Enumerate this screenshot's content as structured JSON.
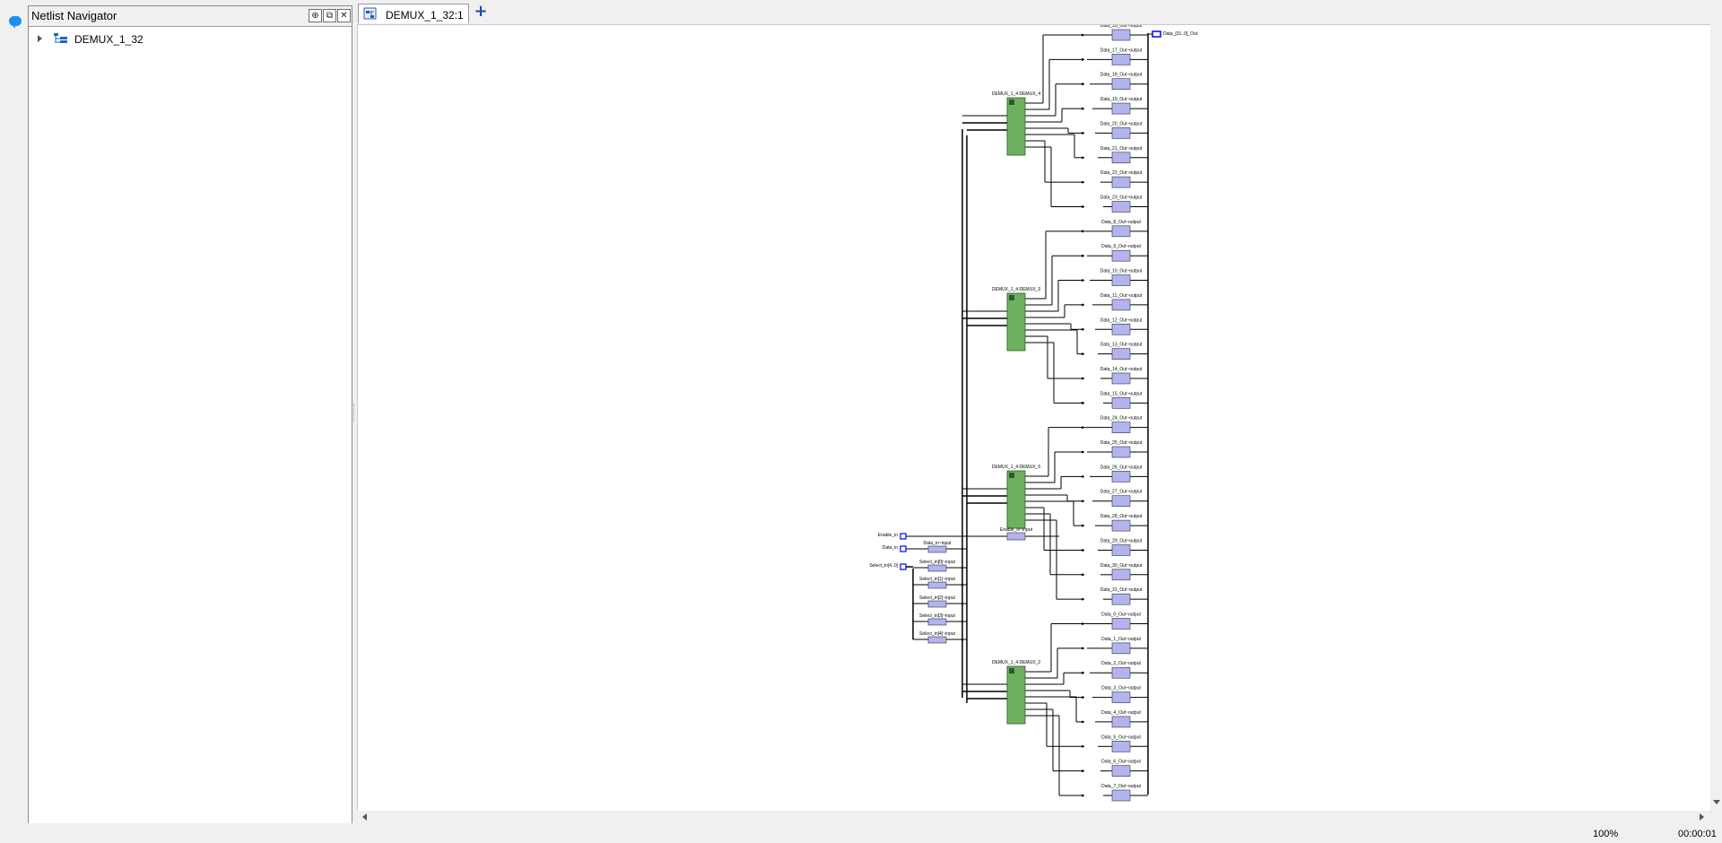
{
  "navigator": {
    "title": "Netlist Navigator",
    "buttons": [
      {
        "name": "pin-icon",
        "glyph": "⊕"
      },
      {
        "name": "float-icon",
        "glyph": "⧉"
      },
      {
        "name": "close-icon",
        "glyph": "✕"
      }
    ],
    "tree": [
      {
        "label": "DEMUX_1_32",
        "expanded": false,
        "icon": "hierarchy-icon"
      }
    ]
  },
  "tabs": [
    {
      "label": "DEMUX_1_32:1",
      "active": true,
      "icon": "schematic-icon"
    }
  ],
  "add_tab_label": "+",
  "status": {
    "zoom": "100%",
    "time": "00:00:01"
  },
  "schematic": {
    "colors": {
      "instance_fill": "#6eb060",
      "pin_fill": "#b3b3f0",
      "wire": "#000000",
      "port_fill": "#0000ff"
    },
    "instances": [
      {
        "label": "DEMUX_1_4:DEMUX_4"
      },
      {
        "label": "DEMUX_1_4:DEMUX_3"
      },
      {
        "label": "DEMUX_1_4:DEMUX_5"
      },
      {
        "label": "DEMUX_1_4:DEMUX_2"
      }
    ],
    "enable_pin": "Enable_in~input",
    "input_ports": [
      "Enable_in",
      "Data_in",
      "Select_in[4..0]"
    ],
    "input_pins": [
      "Data_in~input",
      "Select_in[0]~input",
      "Select_in[1]~input",
      "Select_in[2]~input",
      "Select_in[3]~input",
      "Select_in[4]~input"
    ],
    "output_pins": [
      "Data_16_Out~output",
      "Data_17_Out~output",
      "Data_18_Out~output",
      "Data_19_Out~output",
      "Data_20_Out~output",
      "Data_21_Out~output",
      "Data_22_Out~output",
      "Data_23_Out~output",
      "Data_8_Out~output",
      "Data_9_Out~output",
      "Data_10_Out~output",
      "Data_11_Out~output",
      "Data_12_Out~output",
      "Data_13_Out~output",
      "Data_14_Out~output",
      "Data_15_Out~output",
      "Data_24_Out~output",
      "Data_25_Out~output",
      "Data_26_Out~output",
      "Data_27_Out~output",
      "Data_28_Out~output",
      "Data_29_Out~output",
      "Data_30_Out~output",
      "Data_31_Out~output",
      "Data_0_Out~output",
      "Data_1_Out~output",
      "Data_2_Out~output",
      "Data_3_Out~output",
      "Data_4_Out~output",
      "Data_5_Out~output",
      "Data_6_Out~output",
      "Data_7_Out~output"
    ],
    "output_port": "Data_[31..0]_Out"
  }
}
